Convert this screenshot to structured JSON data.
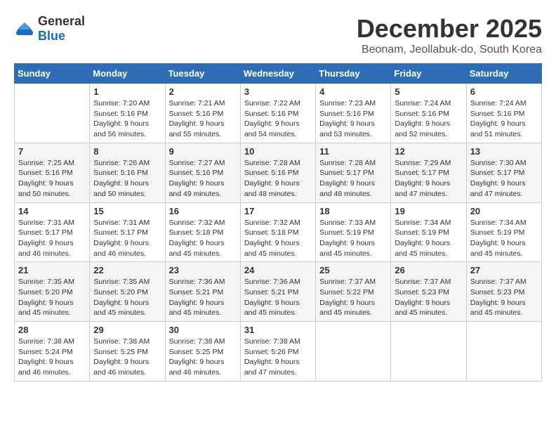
{
  "logo": {
    "general": "General",
    "blue": "Blue"
  },
  "title": {
    "month": "December 2025",
    "location": "Beonam, Jeollabuk-do, South Korea"
  },
  "weekdays": [
    "Sunday",
    "Monday",
    "Tuesday",
    "Wednesday",
    "Thursday",
    "Friday",
    "Saturday"
  ],
  "weeks": [
    [
      {
        "day": "",
        "sunrise": "",
        "sunset": "",
        "daylight": ""
      },
      {
        "day": "1",
        "sunrise": "Sunrise: 7:20 AM",
        "sunset": "Sunset: 5:16 PM",
        "daylight": "Daylight: 9 hours and 56 minutes."
      },
      {
        "day": "2",
        "sunrise": "Sunrise: 7:21 AM",
        "sunset": "Sunset: 5:16 PM",
        "daylight": "Daylight: 9 hours and 55 minutes."
      },
      {
        "day": "3",
        "sunrise": "Sunrise: 7:22 AM",
        "sunset": "Sunset: 5:16 PM",
        "daylight": "Daylight: 9 hours and 54 minutes."
      },
      {
        "day": "4",
        "sunrise": "Sunrise: 7:23 AM",
        "sunset": "Sunset: 5:16 PM",
        "daylight": "Daylight: 9 hours and 53 minutes."
      },
      {
        "day": "5",
        "sunrise": "Sunrise: 7:24 AM",
        "sunset": "Sunset: 5:16 PM",
        "daylight": "Daylight: 9 hours and 52 minutes."
      },
      {
        "day": "6",
        "sunrise": "Sunrise: 7:24 AM",
        "sunset": "Sunset: 5:16 PM",
        "daylight": "Daylight: 9 hours and 51 minutes."
      }
    ],
    [
      {
        "day": "7",
        "sunrise": "Sunrise: 7:25 AM",
        "sunset": "Sunset: 5:16 PM",
        "daylight": "Daylight: 9 hours and 50 minutes."
      },
      {
        "day": "8",
        "sunrise": "Sunrise: 7:26 AM",
        "sunset": "Sunset: 5:16 PM",
        "daylight": "Daylight: 9 hours and 50 minutes."
      },
      {
        "day": "9",
        "sunrise": "Sunrise: 7:27 AM",
        "sunset": "Sunset: 5:16 PM",
        "daylight": "Daylight: 9 hours and 49 minutes."
      },
      {
        "day": "10",
        "sunrise": "Sunrise: 7:28 AM",
        "sunset": "Sunset: 5:16 PM",
        "daylight": "Daylight: 9 hours and 48 minutes."
      },
      {
        "day": "11",
        "sunrise": "Sunrise: 7:28 AM",
        "sunset": "Sunset: 5:17 PM",
        "daylight": "Daylight: 9 hours and 48 minutes."
      },
      {
        "day": "12",
        "sunrise": "Sunrise: 7:29 AM",
        "sunset": "Sunset: 5:17 PM",
        "daylight": "Daylight: 9 hours and 47 minutes."
      },
      {
        "day": "13",
        "sunrise": "Sunrise: 7:30 AM",
        "sunset": "Sunset: 5:17 PM",
        "daylight": "Daylight: 9 hours and 47 minutes."
      }
    ],
    [
      {
        "day": "14",
        "sunrise": "Sunrise: 7:31 AM",
        "sunset": "Sunset: 5:17 PM",
        "daylight": "Daylight: 9 hours and 46 minutes."
      },
      {
        "day": "15",
        "sunrise": "Sunrise: 7:31 AM",
        "sunset": "Sunset: 5:17 PM",
        "daylight": "Daylight: 9 hours and 46 minutes."
      },
      {
        "day": "16",
        "sunrise": "Sunrise: 7:32 AM",
        "sunset": "Sunset: 5:18 PM",
        "daylight": "Daylight: 9 hours and 45 minutes."
      },
      {
        "day": "17",
        "sunrise": "Sunrise: 7:32 AM",
        "sunset": "Sunset: 5:18 PM",
        "daylight": "Daylight: 9 hours and 45 minutes."
      },
      {
        "day": "18",
        "sunrise": "Sunrise: 7:33 AM",
        "sunset": "Sunset: 5:19 PM",
        "daylight": "Daylight: 9 hours and 45 minutes."
      },
      {
        "day": "19",
        "sunrise": "Sunrise: 7:34 AM",
        "sunset": "Sunset: 5:19 PM",
        "daylight": "Daylight: 9 hours and 45 minutes."
      },
      {
        "day": "20",
        "sunrise": "Sunrise: 7:34 AM",
        "sunset": "Sunset: 5:19 PM",
        "daylight": "Daylight: 9 hours and 45 minutes."
      }
    ],
    [
      {
        "day": "21",
        "sunrise": "Sunrise: 7:35 AM",
        "sunset": "Sunset: 5:20 PM",
        "daylight": "Daylight: 9 hours and 45 minutes."
      },
      {
        "day": "22",
        "sunrise": "Sunrise: 7:35 AM",
        "sunset": "Sunset: 5:20 PM",
        "daylight": "Daylight: 9 hours and 45 minutes."
      },
      {
        "day": "23",
        "sunrise": "Sunrise: 7:36 AM",
        "sunset": "Sunset: 5:21 PM",
        "daylight": "Daylight: 9 hours and 45 minutes."
      },
      {
        "day": "24",
        "sunrise": "Sunrise: 7:36 AM",
        "sunset": "Sunset: 5:21 PM",
        "daylight": "Daylight: 9 hours and 45 minutes."
      },
      {
        "day": "25",
        "sunrise": "Sunrise: 7:37 AM",
        "sunset": "Sunset: 5:22 PM",
        "daylight": "Daylight: 9 hours and 45 minutes."
      },
      {
        "day": "26",
        "sunrise": "Sunrise: 7:37 AM",
        "sunset": "Sunset: 5:23 PM",
        "daylight": "Daylight: 9 hours and 45 minutes."
      },
      {
        "day": "27",
        "sunrise": "Sunrise: 7:37 AM",
        "sunset": "Sunset: 5:23 PM",
        "daylight": "Daylight: 9 hours and 45 minutes."
      }
    ],
    [
      {
        "day": "28",
        "sunrise": "Sunrise: 7:38 AM",
        "sunset": "Sunset: 5:24 PM",
        "daylight": "Daylight: 9 hours and 46 minutes."
      },
      {
        "day": "29",
        "sunrise": "Sunrise: 7:38 AM",
        "sunset": "Sunset: 5:25 PM",
        "daylight": "Daylight: 9 hours and 46 minutes."
      },
      {
        "day": "30",
        "sunrise": "Sunrise: 7:38 AM",
        "sunset": "Sunset: 5:25 PM",
        "daylight": "Daylight: 9 hours and 46 minutes."
      },
      {
        "day": "31",
        "sunrise": "Sunrise: 7:38 AM",
        "sunset": "Sunset: 5:26 PM",
        "daylight": "Daylight: 9 hours and 47 minutes."
      },
      {
        "day": "",
        "sunrise": "",
        "sunset": "",
        "daylight": ""
      },
      {
        "day": "",
        "sunrise": "",
        "sunset": "",
        "daylight": ""
      },
      {
        "day": "",
        "sunrise": "",
        "sunset": "",
        "daylight": ""
      }
    ]
  ]
}
